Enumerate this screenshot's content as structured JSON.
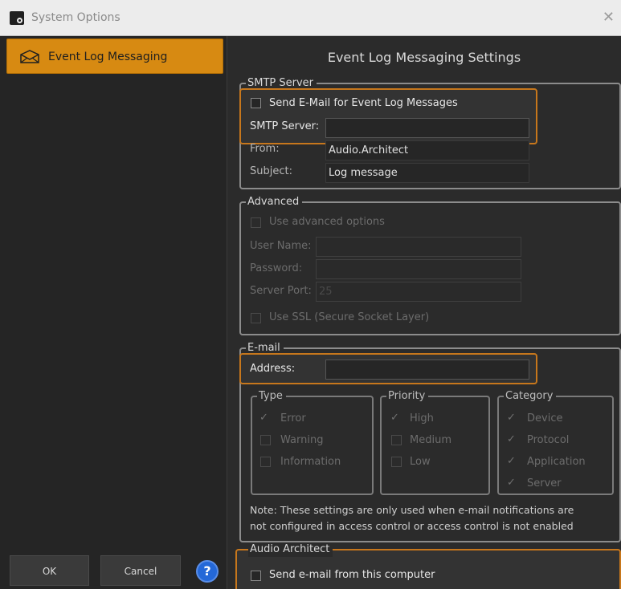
{
  "window": {
    "title": "System Options",
    "close_glyph": "✕",
    "icon": "app-icon"
  },
  "sidebar": {
    "items": [
      {
        "label": "Event Log Messaging",
        "icon": "envelope-icon",
        "selected": true
      }
    ],
    "ok_label": "OK",
    "cancel_label": "Cancel",
    "help_glyph": "?"
  },
  "main": {
    "heading": "Event Log Messaging Settings",
    "smtp": {
      "legend": "SMTP Server",
      "send_checkbox_label": "Send E-Mail for Event Log Messages",
      "send_checked": false,
      "server_label": "SMTP Server:",
      "server_value": "",
      "from_label": "From:",
      "from_value": "Audio.Architect",
      "subject_label": "Subject:",
      "subject_value": "Log message"
    },
    "advanced": {
      "legend": "Advanced",
      "use_advanced_label": "Use advanced options",
      "user_label": "User Name:",
      "user_value": "",
      "password_label": "Password:",
      "password_value": "",
      "port_label": "Server Port:",
      "port_value": "25",
      "ssl_label": "Use SSL (Secure Socket Layer)"
    },
    "email": {
      "legend": "E-mail",
      "address_label": "Address:",
      "address_value": "",
      "type": {
        "legend": "Type",
        "items": [
          {
            "label": "Error",
            "checked": true
          },
          {
            "label": "Warning",
            "checked": false
          },
          {
            "label": "Information",
            "checked": false
          }
        ]
      },
      "priority": {
        "legend": "Priority",
        "items": [
          {
            "label": "High",
            "checked": true
          },
          {
            "label": "Medium",
            "checked": false
          },
          {
            "label": "Low",
            "checked": false
          }
        ]
      },
      "category": {
        "legend": "Category",
        "items": [
          {
            "label": "Device",
            "checked": true
          },
          {
            "label": "Protocol",
            "checked": true
          },
          {
            "label": "Application",
            "checked": true
          },
          {
            "label": "Server",
            "checked": true
          }
        ]
      },
      "note_line1": "Note: These settings are only used when e-mail notifications are",
      "note_line2": "not configured in access control or access control is not enabled"
    },
    "audio_architect": {
      "legend": "Audio Architect",
      "send_label": "Send e-mail from this computer",
      "send_checked": false
    }
  },
  "colors": {
    "accent": "#d78a12",
    "highlight_border": "#c7771c",
    "help_blue": "#2468d8"
  },
  "checkmark_glyph": "✓"
}
